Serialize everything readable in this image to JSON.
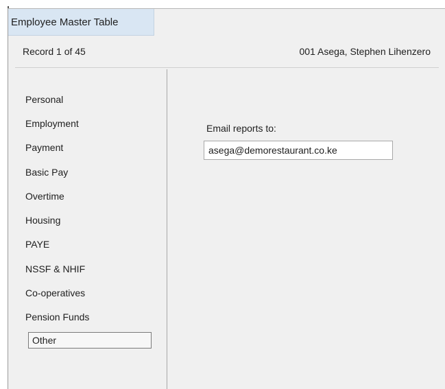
{
  "window": {
    "title": "Employee Master Table"
  },
  "record_bar": {
    "record_count": "Record 1 of 45",
    "employee": "001  Asega, Stephen Lihenzero"
  },
  "nav": {
    "items": [
      {
        "label": "Personal"
      },
      {
        "label": "Employment"
      },
      {
        "label": "Payment"
      },
      {
        "label": "Basic Pay"
      },
      {
        "label": "Overtime"
      },
      {
        "label": "Housing"
      },
      {
        "label": "PAYE"
      },
      {
        "label": "NSSF & NHIF"
      },
      {
        "label": "Co-operatives"
      },
      {
        "label": "Pension Funds"
      },
      {
        "label": "Other"
      }
    ],
    "selected": "Other"
  },
  "content": {
    "email_label": "Email reports to:",
    "email_value": "asega@demorestaurant.co.ke"
  },
  "colors": {
    "title_tab_bg": "#d9e6f3",
    "panel_bg": "#f0f0f0",
    "input_bg": "#ffffff"
  }
}
